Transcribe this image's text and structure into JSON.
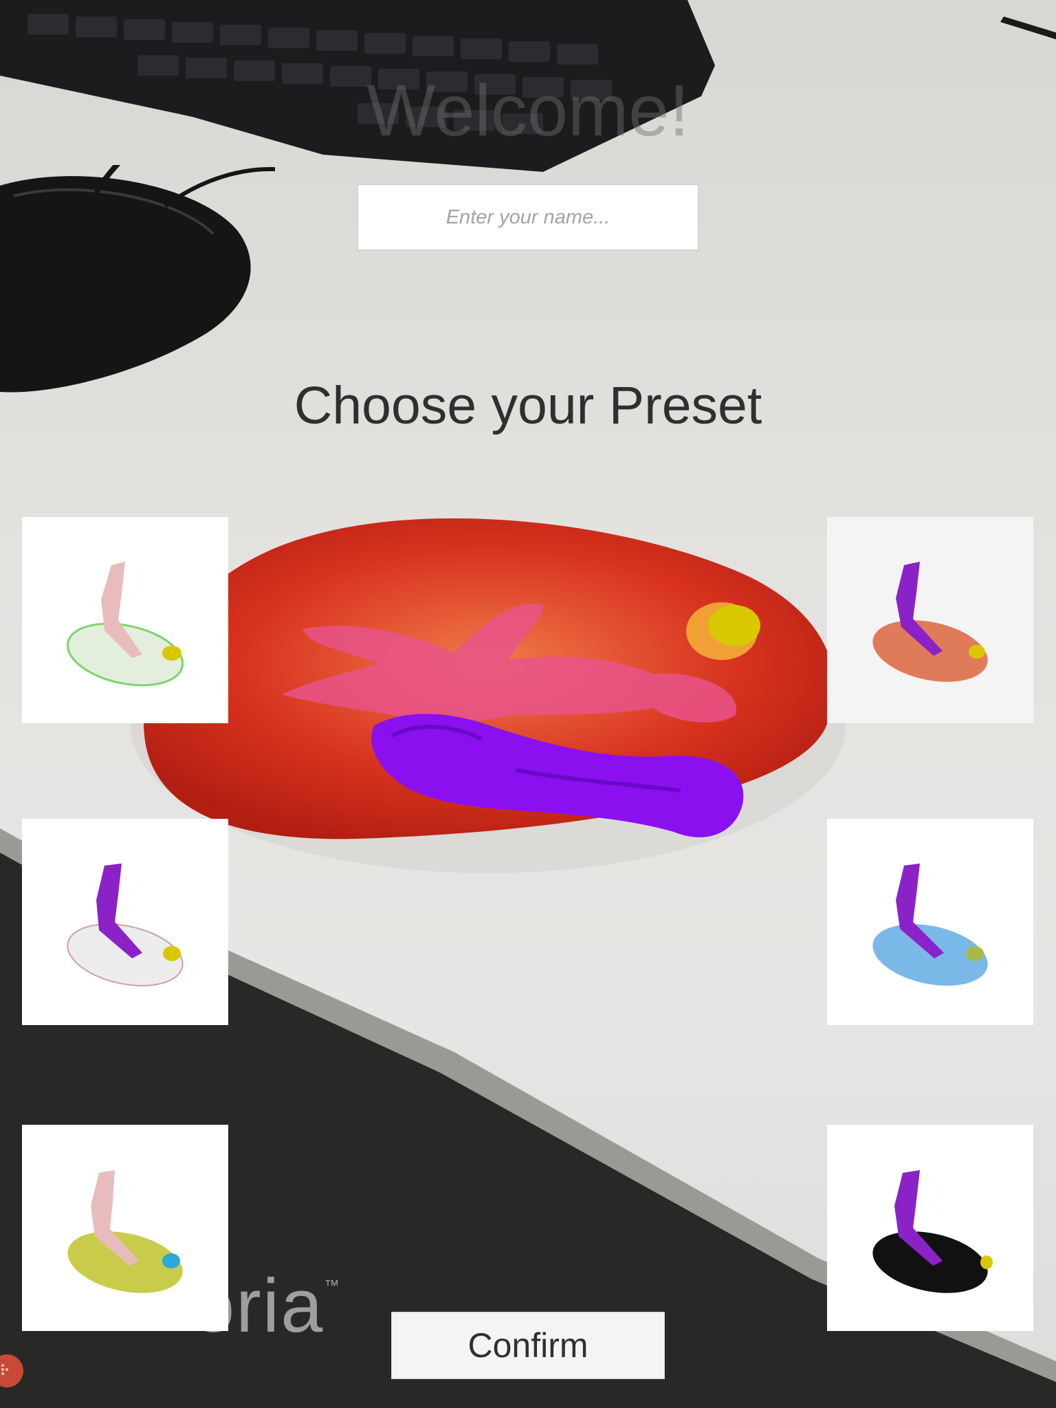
{
  "header": {
    "welcome_title": "Welcome!",
    "name_placeholder": "Enter your name..."
  },
  "presets": {
    "title": "Choose your Preset",
    "items": [
      {
        "id": "preset-1",
        "colors": {
          "capsule": "#e3efdc",
          "tube": "#e8bcbc",
          "ball": "#d8c800"
        }
      },
      {
        "id": "preset-2",
        "colors": {
          "capsule": "#e07b5a",
          "tube": "#8a22c8",
          "ball": "#d8c800"
        }
      },
      {
        "id": "preset-3",
        "colors": {
          "capsule": "#ececec",
          "tube": "#8a22c8",
          "ball": "#d8c800"
        }
      },
      {
        "id": "preset-4",
        "colors": {
          "capsule": "#7ab8e8",
          "tube": "#8a22c8",
          "ball": "#a8b84a"
        }
      },
      {
        "id": "preset-5",
        "colors": {
          "capsule": "#c9cc4a",
          "tube": "#e8bcbc",
          "ball": "#2aa8d8"
        }
      },
      {
        "id": "preset-6",
        "colors": {
          "capsule": "#111111",
          "tube": "#8a22c8",
          "ball": "#d8c800"
        }
      }
    ]
  },
  "footer": {
    "confirm_label": "Confirm",
    "watermark": "oria",
    "watermark_tm": "™"
  },
  "theme": {
    "model_red": "#d8321e",
    "model_pink": "#e8548a",
    "model_purple": "#8a10f0"
  }
}
